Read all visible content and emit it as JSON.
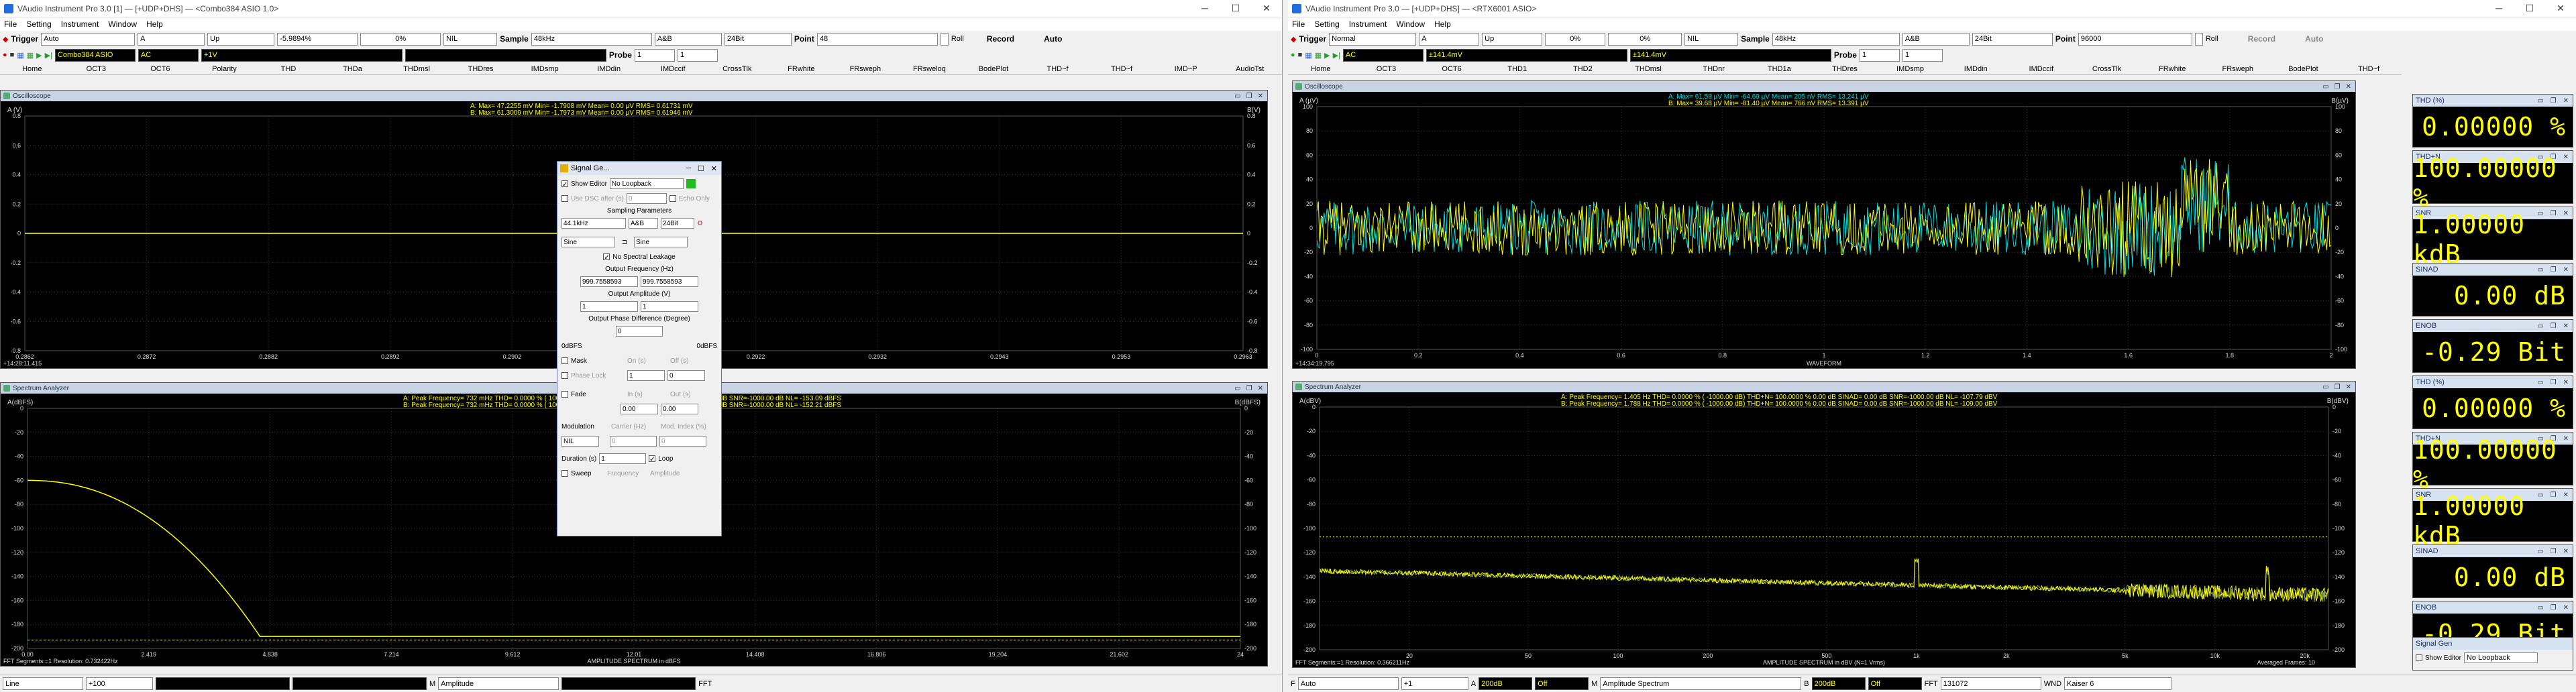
{
  "left": {
    "title": "VAudio Instrument Pro 3.0  [1]  — [+UDP+DHS]  — <Combo384 ASIO 1.0>",
    "menu": [
      "File",
      "Setting",
      "Instrument",
      "Window",
      "Help"
    ],
    "trigger_label": "Trigger",
    "trigger_mode": "Auto",
    "trigger_ch": "A",
    "trigger_edge": "Up",
    "trigger_level": "-5.9894%",
    "trigger_pct": "0%",
    "null_mode": "NIL",
    "sample_label": "Sample",
    "sample_rate": "48kHz",
    "ch_mode": "A&B",
    "bits": "24Bit",
    "point_label": "Point",
    "point_value": "48",
    "roll_label": "Roll",
    "record_label": "Record",
    "auto_label": "Auto",
    "row2": {
      "ch_a": "Combo384 ASIO",
      "coupling": "AC",
      "vrange": "+1V",
      "probe_label": "Probe",
      "probe": "1"
    },
    "tabs": [
      "Home",
      "OCT3",
      "OCT6",
      "Polarity",
      "THD",
      "THDa",
      "THDmsl",
      "THDres",
      "IMDsmp",
      "IMDdin",
      "IMDccif",
      "CrossTlk",
      "FRwhite",
      "FRsweph",
      "FRsweloq",
      "BodePlot",
      "THD~f",
      "THD~f",
      "IMD~P",
      "AudioTst"
    ],
    "osc": {
      "title": "Oscilloscope",
      "ylabel": "A (V)",
      "yright": "B(V)",
      "readout_a": "A:  Max=    47.2255 mV  Min=    -1.7908 mV  Mean=       0.00  µV  RMS=    0.61731 mV",
      "readout_b": "B:  Max=    61.3009 mV  Min=    -1.7973 mV  Mean=       0.00  µV  RMS=    0.61946 mV",
      "yticks": [
        "0.8",
        "0.6",
        "0.4",
        "0.2",
        "0",
        "-0.2",
        "-0.4",
        "-0.6",
        "-0.8"
      ],
      "xticks": [
        "0.2862",
        "0.2872",
        "0.2882",
        "0.2892",
        "0.2902",
        "0.2912",
        "0.2922",
        "0.2932",
        "0.2943",
        "0.2953",
        "0.2963"
      ],
      "time_label": "+14:28:11.415"
    },
    "spec": {
      "title": "Spectrum Analyzer",
      "ylabel": "A(dBFS)",
      "yright": "B(dBFS)",
      "readout_a": "A:  Peak Frequency=       732  mHz  THD=    0.0000 %  ( 1000.00 dB)  THD+N=  100.0000 %     0.00 dB   SINAD=    0.00 dB   SNR=-1000.00 dB   NL=  -153.09 dBFS",
      "readout_b": "B:  Peak Frequency=       732  mHz  THD=    0.0000 %  ( 1000.00 dB)  THD+N=  100.0000 %     0.00 dB   SINAD=    0.00 dB   SNR=-1000.00 dB   NL=  -152.21 dBFS",
      "yticks": [
        "0",
        "-20",
        "-40",
        "-60",
        "-80",
        "-100",
        "-120",
        "-140",
        "-160",
        "-180",
        "-200"
      ],
      "xticks": [
        "0.00",
        "2.419",
        "4.838",
        "7.214",
        "9.612",
        "12.01",
        "14.408",
        "16.806",
        "19.204",
        "21.602",
        "24"
      ],
      "footer_left": "FFT Segments:=1     Resolution: 0.732422Hz",
      "footer_center": "AMPLITUDE SPECTRUM in dBFS"
    },
    "bottom": {
      "f": "Line",
      "scale": "+100",
      "m": "M",
      "amp": "Amplitude",
      "fft": "FFT"
    }
  },
  "dialog": {
    "title": "Signal Ge...",
    "show_editor": "Show Editor",
    "loopback": "No Loopback",
    "use_dac": "Use DSC after (s)",
    "use_dac_val": "0",
    "echo": "Echo Only",
    "sampling": "Sampling Parameters",
    "rate": "44.1kHz",
    "ch": "A&B",
    "bits": "24Bit",
    "wave_a": "Sine",
    "wave_b": "Sine",
    "no_leak": "No Spectral Leakage",
    "out_freq": "Output Frequency (Hz)",
    "freq_a": "999.7558593",
    "freq_b": "999.7558593",
    "out_amp": "Output Amplitude (V)",
    "amp_a": "1",
    "amp_b": "1",
    "phase": "Output Phase Difference (Degree)",
    "phase_val": "0",
    "dbfs_l": "0dBFS",
    "dbfs_r": "0dBFS",
    "mask": "Mask",
    "on": "On (s)",
    "off": "Off (s)",
    "phase_lock": "Phase Lock",
    "pl_a": "1",
    "pl_b": "0",
    "fade": "Fade",
    "in": "In (s)",
    "out": "Out (s)",
    "fade_in": "0.00",
    "fade_out": "0.00",
    "modulation": "Modulation",
    "carrier": "Carrier (Hz)",
    "mod_index": "Mod. Index (%)",
    "mod_mode": "NIL",
    "carrier_val": "0",
    "index_val": "0",
    "duration": "Duration (s)",
    "duration_val": "1",
    "loop": "Loop",
    "sweep": "Sweep",
    "frequency": "Frequency",
    "amplitude": "Amplitude"
  },
  "right": {
    "title": "VAudio Instrument Pro 3.0  — [+UDP+DHS]  — <RTX6001 ASIO>",
    "menu": [
      "File",
      "Setting",
      "Instrument",
      "Window",
      "Help"
    ],
    "trigger_label": "Trigger",
    "trigger_mode": "Normal",
    "trigger_ch": "A",
    "trigger_edge": "Up",
    "trigger_level": "0%",
    "trigger_pct": "0%",
    "null_mode": "NIL",
    "sample_label": "Sample",
    "sample_rate": "48kHz",
    "ch_mode": "A&B",
    "bits": "24Bit",
    "point_label": "Point",
    "point_value": "96000",
    "roll_label": "Roll",
    "record_label": "Record",
    "auto_label": "Auto",
    "row2": {
      "coupling": "AC",
      "vrange_a": "±141.4mV",
      "vrange_b": "±141.4mV",
      "probe_label": "Probe",
      "probe": "1"
    },
    "tabs": [
      "Home",
      "OCT3",
      "OCT6",
      "THD1",
      "THD2",
      "THDmsl",
      "THDnr",
      "THD1a",
      "THDres",
      "IMDsmp",
      "IMDdin",
      "IMDccif",
      "CrossTlk",
      "FRwhite",
      "FRsweph",
      "BodePlot",
      "THD~f"
    ],
    "osc": {
      "title": "Oscilloscope",
      "ylabel": "A (µV)",
      "yright": "B(µV)",
      "readout_a": "A:  Max=    61.58  µV  Min=   -64.69  µV  Mean=     205  nV  RMS=     13.241  µV",
      "readout_b": "B:  Max=    39.68  µV  Min=   -81.40  µV  Mean=     766  nV  RMS=     13.391  µV",
      "yticks": [
        "100",
        "80",
        "60",
        "40",
        "20",
        "0",
        "-20",
        "-40",
        "-60",
        "-80",
        "-100"
      ],
      "xticks": [
        "0",
        "0.2",
        "0.4",
        "0.6",
        "0.8",
        "1",
        "1.2",
        "1.4",
        "1.6",
        "1.8",
        "2"
      ],
      "footer_center": "WAVEFORM",
      "time_label": "+14:34:19.795"
    },
    "spec": {
      "title": "Spectrum Analyzer",
      "ylabel": "A(dBV)",
      "yright": "B(dBV)",
      "readout_a": "A:  Peak Frequency=     1.405   Hz  THD=    0.0000 %  ( -1000.00 dB)  THD+N=  100.0000 %     0.00 dB   SINAD=    0.00 dB   SNR=-1000.00 dB   NL=  -107.79 dBV",
      "readout_b": "B:  Peak Frequency=     1.788   Hz  THD=    0.0000 %  ( -1000.00 dB)  THD+N=  100.0000 %     0.00 dB   SINAD=    0.00 dB   SNR=-1000.00 dB   NL=  -109.00 dBV",
      "yticks": [
        "0",
        "-20",
        "-40",
        "-60",
        "-80",
        "-100",
        "-120",
        "-140",
        "-160",
        "-180",
        "-200"
      ],
      "xticks": [
        "20",
        "50",
        "100",
        "200",
        "500",
        "1k",
        "2k",
        "5k",
        "10k",
        "20k"
      ],
      "footer_left": "FFT Segments:=1     Resolution: 0.366211Hz",
      "footer_center": "AMPLITUDE SPECTRUM in dBV (N=1 Vrms)",
      "footer_right": "Averaged Frames: 10"
    },
    "bottom": {
      "f": "F",
      "mode": "Auto",
      "scale": "+1",
      "a": "A",
      "a_range": "200dB",
      "a_off": "Off",
      "m": "M",
      "amp": "Amplitude Spectrum",
      "b": "B",
      "b_range": "200dB",
      "b_off": "Off",
      "fft": "FFT",
      "points": "131072",
      "wnd": "WND",
      "window": "Kaiser 6"
    }
  },
  "meters": [
    {
      "title": "THD (%)",
      "value": "0.00000 %"
    },
    {
      "title": "THD+N",
      "value": "100.00000 %"
    },
    {
      "title": "SNR",
      "value": "1.00000 kdB"
    },
    {
      "title": "SINAD",
      "value": "0.00 dB"
    },
    {
      "title": "ENOB",
      "value": "-0.29 Bit"
    },
    {
      "title": "THD (%)",
      "value": "0.00000 %"
    },
    {
      "title": "THD+N",
      "value": "100.00000 %"
    },
    {
      "title": "SNR",
      "value": "1.00000 kdB"
    },
    {
      "title": "SINAD",
      "value": "0.00 dB"
    },
    {
      "title": "ENOB",
      "value": "-0.29 Bit"
    }
  ],
  "mini_dialog": {
    "title": "Signal Gen",
    "show_editor": "Show Editor",
    "loopback": "No Loopback"
  },
  "colors": {
    "trace_a": "#ffff00",
    "trace_b": "#00e0e0",
    "grid": "#3a3a3a",
    "zero": "#c8c800"
  }
}
